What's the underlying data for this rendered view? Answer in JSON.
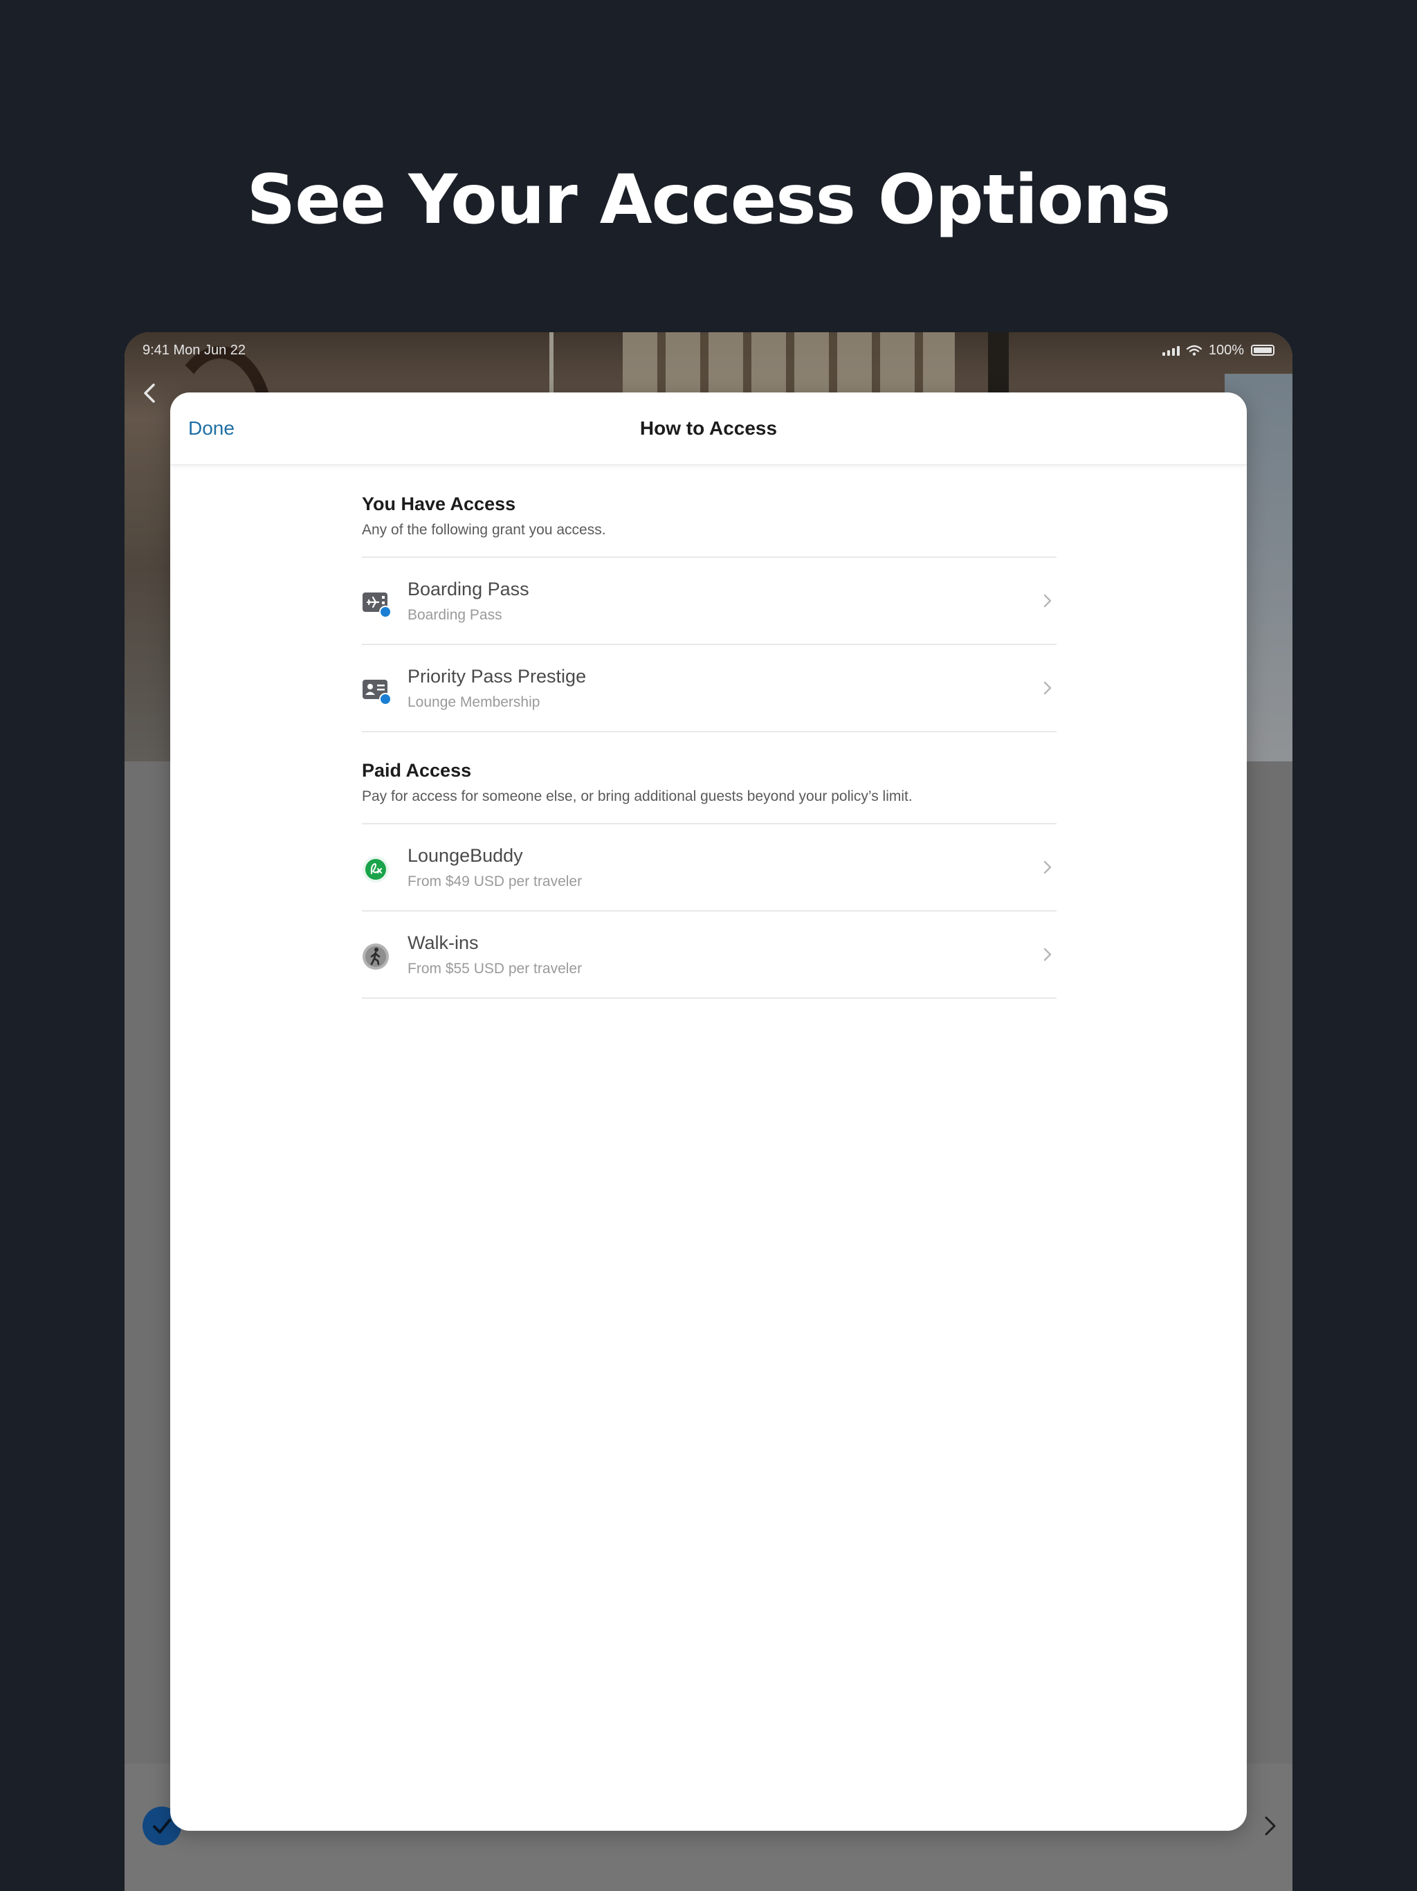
{
  "headline": "See Your Access Options",
  "status_bar": {
    "time": "9:41 Mon Jun 22",
    "battery": "100%"
  },
  "sheet": {
    "done_label": "Done",
    "title": "How to Access"
  },
  "sections": [
    {
      "title": "You Have Access",
      "subtitle": "Any of the following grant you access.",
      "items": [
        {
          "title": "Boarding Pass",
          "subtitle": "Boarding Pass",
          "icon": "boarding-pass-icon"
        },
        {
          "title": "Priority Pass Prestige",
          "subtitle": "Lounge Membership",
          "icon": "membership-card-icon"
        }
      ]
    },
    {
      "title": "Paid Access",
      "subtitle": "Pay for access for someone else, or bring additional guests beyond your policy’s limit.",
      "items": [
        {
          "title": "LoungeBuddy",
          "subtitle": "From $49 USD per traveler",
          "icon": "loungebuddy-logo-icon"
        },
        {
          "title": "Walk-ins",
          "subtitle": "From $55 USD per traveler",
          "icon": "walking-person-icon"
        }
      ]
    }
  ],
  "colors": {
    "background": "#1b1f27",
    "accent": "#1f6fa3",
    "badge_blue": "#1a7fd4",
    "loungebuddy_green": "#1aa34a"
  }
}
